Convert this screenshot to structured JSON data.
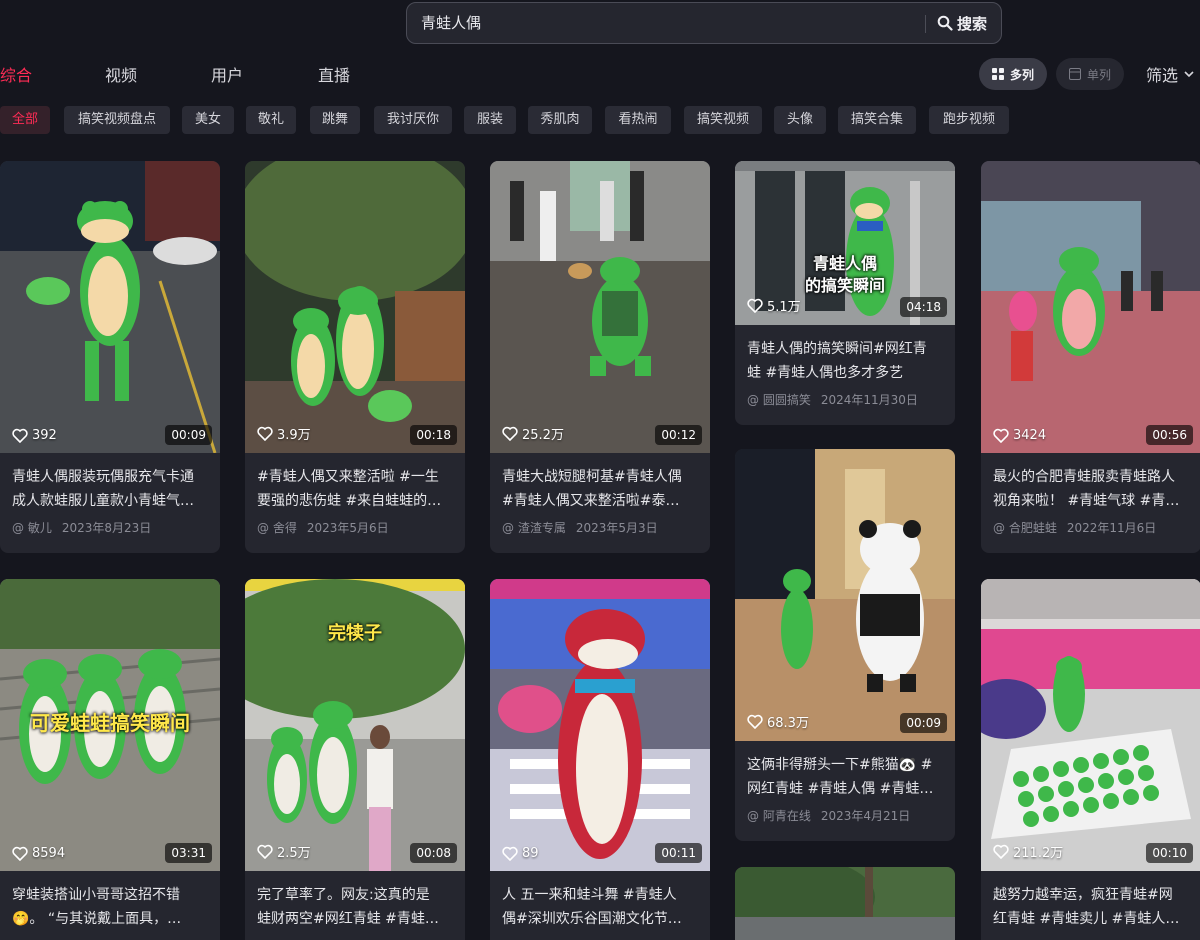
{
  "search": {
    "query": "青蛙人偶",
    "button_label": "搜索"
  },
  "tabs": [
    {
      "label": "综合"
    },
    {
      "label": "视频"
    },
    {
      "label": "用户"
    },
    {
      "label": "直播"
    }
  ],
  "view_modes": {
    "multi_label": "多列",
    "single_label": "单列",
    "filter_label": "筛选"
  },
  "chips": [
    "全部",
    "搞笑视频盘点",
    "美女",
    "敬礼",
    "跳舞",
    "我讨厌你",
    "服装",
    "秀肌肉",
    "看热闹",
    "搞笑视频",
    "头像",
    "搞笑合集",
    "跑步视频"
  ],
  "colors": {
    "accent": "#fe2c55",
    "frog_green": "#3fb84a",
    "background": "#15161e"
  },
  "cards": [
    {
      "likes": "392",
      "duration": "00:09",
      "desc": [
        "青蛙人偶服装玩偶服充气卡通",
        "成人款蛙服儿童款小青蛙气…"
      ],
      "author": "敏儿",
      "date": "2023年8月23日",
      "overlay": ""
    },
    {
      "likes": "3.9万",
      "duration": "00:18",
      "desc": [
        "#青蛙人偶又来整活啦 #一生",
        "要强的悲伤蛙 #来自蛙蛙的…"
      ],
      "author": "舍得",
      "date": "2023年5月6日",
      "overlay": ""
    },
    {
      "likes": "25.2万",
      "duration": "00:12",
      "desc": [
        "青蛙大战短腿柯基#青蛙人偶",
        "#青蛙人偶又来整活啦#泰…"
      ],
      "author": "渣渣专属",
      "date": "2023年5月3日",
      "overlay": ""
    },
    {
      "likes": "5.1万",
      "duration": "04:18",
      "desc": [
        "青蛙人偶的搞笑瞬间#网红青",
        "蛙 #青蛙人偶也多才多艺"
      ],
      "author": "圆圆搞笑",
      "date": "2024年11月30日",
      "overlay": "青蛙人偶\n的搞笑瞬间"
    },
    {
      "likes": "3424",
      "duration": "00:56",
      "desc": [
        "最火的合肥青蛙服卖青蛙路人",
        "视角来啦！ #青蛙气球 #青…"
      ],
      "author": "合肥蛙蛙",
      "date": "2022年11月6日",
      "overlay": ""
    },
    {
      "likes": "8594",
      "duration": "03:31",
      "desc": [
        "穿蛙装搭讪小哥哥这招不错",
        "🤭。 “与其说戴上面具，…"
      ],
      "author": "",
      "date": "",
      "overlay": "可爱蛙蛙搞笑瞬间"
    },
    {
      "likes": "2.5万",
      "duration": "00:08",
      "desc": [
        "完了草率了。网友:这真的是",
        "蛙财两空#网红青蛙 #青蛙…"
      ],
      "author": "",
      "date": "",
      "overlay": "完犊子"
    },
    {
      "likes": "89",
      "duration": "00:11",
      "desc": [
        "人 五一来和蛙斗舞 #青蛙人",
        "偶#深圳欢乐谷国潮文化节…"
      ],
      "author": "",
      "date": "",
      "overlay": ""
    },
    {
      "likes": "68.3万",
      "duration": "00:09",
      "desc": [
        "这俩非得掰头一下#熊猫🐼 #",
        "网红青蛙 #青蛙人偶 #青蛙…"
      ],
      "author": "阿青在线",
      "date": "2023年4月21日",
      "overlay": ""
    },
    {
      "likes": "211.2万",
      "duration": "00:10",
      "desc": [
        "越努力越幸运，疯狂青蛙#网",
        "红青蛙 #青蛙卖儿 #青蛙人…"
      ],
      "author": "",
      "date": "",
      "overlay": ""
    }
  ]
}
